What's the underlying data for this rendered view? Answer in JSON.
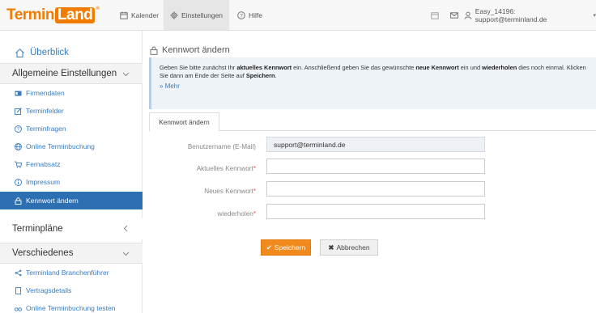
{
  "brand": {
    "part1": "Termin",
    "part2": "Land",
    "mark": "®"
  },
  "topnav": {
    "calendar_label": "Kalender",
    "settings_label": "Einstellungen",
    "help_label": "Hilfe",
    "user_label": "Easy_14196: support@terminland.de"
  },
  "sidebar": {
    "overview_label": "Überblick",
    "sections": {
      "general": "Allgemeine Einstellungen",
      "plans": "Terminpläne",
      "misc": "Verschiedenes"
    },
    "general_items": [
      {
        "label": "Firmendaten",
        "icon": "id-card-icon"
      },
      {
        "label": "Terminfelder",
        "icon": "edit-icon"
      },
      {
        "label": "Terminfragen",
        "icon": "question-icon"
      },
      {
        "label": "Online Terminbuchung",
        "icon": "globe-icon"
      },
      {
        "label": "Fernabsatz",
        "icon": "cart-icon"
      },
      {
        "label": "Impressum",
        "icon": "info-icon"
      },
      {
        "label": "Kennwort ändern",
        "icon": "lock-icon"
      }
    ],
    "misc_items": [
      {
        "label": "Terminland Branchenführer",
        "icon": "share-icon"
      },
      {
        "label": "Vertragsdetails",
        "icon": "document-icon"
      },
      {
        "label": "Online Terminbuchung testen",
        "icon": "glasses-icon"
      }
    ]
  },
  "page": {
    "title": "Kennwort ändern",
    "info": {
      "p1": "Geben Sie bitte zunächst Ihr ",
      "b1": "aktuelles Kennwort",
      "p2": " ein. Anschließend geben Sie das gewünschte ",
      "b2": "neue Kennwort",
      "p3": " ein und ",
      "b3": "wiederholen",
      "p4": " dies noch einmal. Klicken Sie dann am Ende der Seite auf ",
      "b4": "Speichern",
      "p5": ".",
      "more": "Mehr"
    },
    "tab_label": "Kennwort ändern",
    "fields": {
      "username_label": "Benutzername (E-Mail)",
      "username_value": "support@terminland.de",
      "current_label": "Aktuelles Kennwort",
      "new_label": "Neues Kennwort",
      "repeat_label": "wiederholen",
      "required_mark": "*"
    },
    "buttons": {
      "save": "Speichern",
      "cancel": "Abbrechen"
    }
  },
  "colors": {
    "accent": "#f07d00",
    "link": "#3a7bbf",
    "active_nav": "#2d6fb3",
    "save_button": "#f08a1c"
  }
}
